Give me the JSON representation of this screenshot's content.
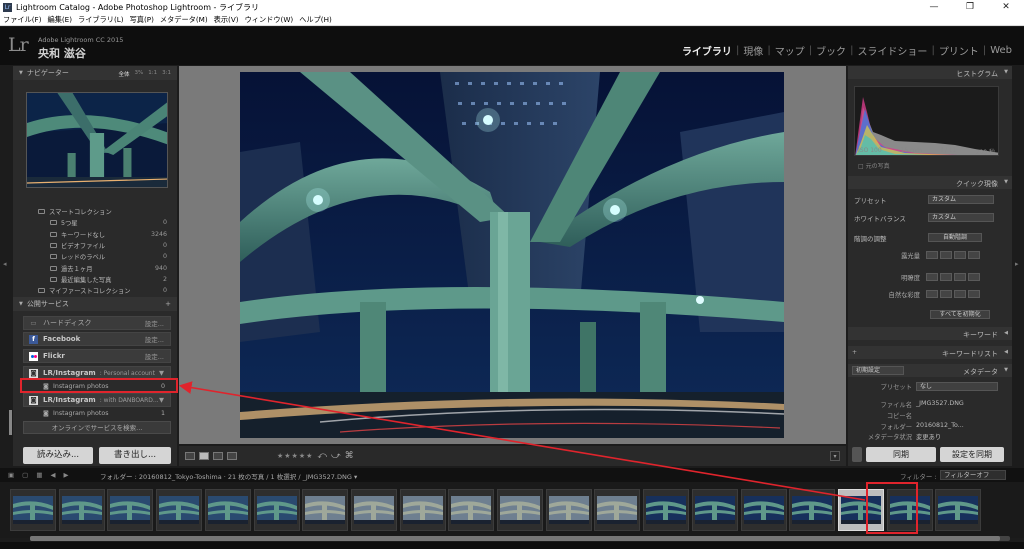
{
  "window": {
    "title": "Lightroom Catalog - Adobe Photoshop Lightroom - ライブラリ",
    "minimize": "—",
    "maximize": "❐",
    "close": "✕"
  },
  "menu": [
    "ファイル(F)",
    "編集(E)",
    "ライブラリ(L)",
    "写真(P)",
    "メタデータ(M)",
    "表示(V)",
    "ウィンドウ(W)",
    "ヘルプ(H)"
  ],
  "identity": {
    "logo": "Lr",
    "version": "Adobe Lightroom CC 2015",
    "user": "央和 滋谷"
  },
  "modules": {
    "active": "ライブラリ",
    "items": [
      "現像",
      "マップ",
      "ブック",
      "スライドショー",
      "プリント",
      "Web"
    ]
  },
  "navigator": {
    "title": "ナビゲーター",
    "zooms": [
      "全体",
      "3%",
      "1:1",
      "3:1"
    ]
  },
  "collections": [
    {
      "name": "スマートコレクション",
      "count": "",
      "level": "top"
    },
    {
      "name": "5つ星",
      "count": "0"
    },
    {
      "name": "キーワードなし",
      "count": "3246"
    },
    {
      "name": "ビデオファイル",
      "count": "0"
    },
    {
      "name": "レッドのラベル",
      "count": "0"
    },
    {
      "name": "過去１ヶ月",
      "count": "940"
    },
    {
      "name": "最近編集した写真",
      "count": "2"
    },
    {
      "name": "マイファーストコレクション",
      "count": "0",
      "level": "top"
    }
  ],
  "publish": {
    "title": "公開サービス",
    "harddisk": {
      "label": "ハードディスク",
      "action": "設定..."
    },
    "facebook": {
      "label": "Facebook",
      "action": "設定..."
    },
    "flickr": {
      "label": "Flickr",
      "action": "設定..."
    },
    "instagram1": {
      "label": "LR/Instagram",
      "sub": ": Personal account"
    },
    "instagram1_photos": {
      "name": "Instagram photos",
      "count": "0"
    },
    "instagram2": {
      "label": "LR/Instagram",
      "sub": ": with DANBOARD..."
    },
    "instagram2_photos": {
      "name": "Instagram photos",
      "count": "1"
    },
    "find_more": "オンラインでサービスを検索..."
  },
  "left_buttons": {
    "import": "読み込み...",
    "export": "書き出し..."
  },
  "toolbar": {
    "stars": "★★★★★",
    "rotate_left": "⤺",
    "rotate_right": "⤻",
    "dropdown": "▾"
  },
  "histogram": {
    "title": "ヒストグラム",
    "iso": "ISO 100",
    "focal": "15 mm",
    "aperture": "f / 11",
    "shutter": "200 秒",
    "original": "元の写真"
  },
  "quick_develop": {
    "title": "クイック現像",
    "preset_label": "プリセット",
    "preset_value": "カスタム",
    "wb_label": "ホワイトバランス",
    "wb_value": "カスタム",
    "tone_label": "階調の調整",
    "auto_tone": "自動階調",
    "exposure": "露光量",
    "clarity": "明瞭度",
    "vibrance": "自然な彩度",
    "reset": "すべてを初期化"
  },
  "keywords": {
    "title": "キーワード"
  },
  "keyword_list": {
    "title": "キーワードリスト"
  },
  "metadata": {
    "title": "メタデータ",
    "preset_mode": "初期設定",
    "preset_label": "プリセット",
    "preset_value": "なし",
    "rows": [
      {
        "label": "ファイル名",
        "value": "_JMG3527.DNG"
      },
      {
        "label": "コピー名",
        "value": ""
      },
      {
        "label": "フォルダー",
        "value": "20160812_To..."
      },
      {
        "label": "メタデータ状況",
        "value": "変更あり"
      }
    ]
  },
  "sync": {
    "sync_button": "同期",
    "sync_settings": "設定を同期"
  },
  "filmstrip": {
    "path": "フォルダー : 20160812_Tokyo-Toshima · 21 枚の写真 / 1 枚選択 / _JMG3527.DNG ▾",
    "filter_label": "フィルター :",
    "filter_value": "フィルターオフ",
    "selected_index": 17,
    "count": 20
  },
  "colors": {
    "accent_red": "#e0242c",
    "panel": "#2a2a2a",
    "center_bg": "#7a7a7a"
  }
}
